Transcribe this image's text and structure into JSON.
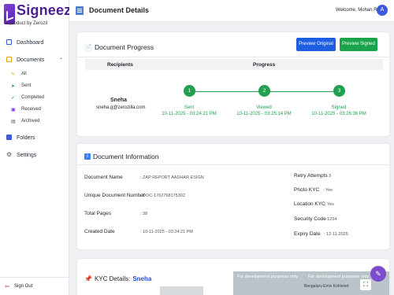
{
  "brand": {
    "name": "Signeez",
    "tagline": "A product by Zerozil",
    "toggle_icon": "double-chevron-left-icon"
  },
  "sidebar": {
    "items": [
      {
        "label": "Dashboard",
        "icon": "dashboard-icon",
        "color": "#3b5bdb"
      },
      {
        "label": "Documents",
        "icon": "document-icon",
        "color": "#e8a317"
      },
      {
        "label": "Folders",
        "icon": "folder-icon",
        "color": "#3b5bdb"
      },
      {
        "label": "Settings",
        "icon": "gear-icon",
        "color": "#555555"
      }
    ],
    "sub_items": [
      {
        "label": "All",
        "icon": "pen-icon"
      },
      {
        "label": "Sent",
        "icon": "send-icon"
      },
      {
        "label": "Completed",
        "icon": "check-icon"
      },
      {
        "label": "Received",
        "icon": "inbox-icon"
      },
      {
        "label": "Archived",
        "icon": "archive-icon"
      }
    ],
    "sign_out": "Sign Out"
  },
  "header": {
    "title": "Document Details",
    "welcome": "Welcome, Mohan Raj",
    "avatar_initial": "A"
  },
  "progress": {
    "title": "Document Progress",
    "preview_original": "Preview Original",
    "preview_signed": "Preview Signed",
    "col_recipients": "Recipients",
    "col_progress": "Progress",
    "recipient_name": "Sneha",
    "recipient_email": "sneha.g@zerozilla.com",
    "steps": [
      {
        "num": "1",
        "label": "Sent",
        "date": "10-11-2025 - 03:24:21 PM"
      },
      {
        "num": "2",
        "label": "Viewed",
        "date": "10-11-2025 - 03:25:14 PM"
      },
      {
        "num": "3",
        "label": "Signed",
        "date": "10-11-2025 - 03:26:36 PM"
      }
    ]
  },
  "info": {
    "title": "Document Information",
    "left": [
      {
        "label": "Document Name",
        "value": ": ZAP REPORT AADHAR ESIGN"
      },
      {
        "label": "Unique Document Number",
        "value": ": DOC-1762768175302"
      },
      {
        "label": "Total Pages",
        "value": ": 38"
      },
      {
        "label": "Created Date",
        "value": ": 10-11-2025 - 03:24:21 PM"
      }
    ],
    "right": [
      {
        "label": "Retry Attempts",
        "value": ": 3"
      },
      {
        "label": "Photo KYC",
        "value": ": Yes"
      },
      {
        "label": "Location KYC",
        "value": ": Yes"
      },
      {
        "label": "Security Code",
        "value": ": 1234"
      },
      {
        "label": "Expiry Date",
        "value": ": 12-11-2025"
      }
    ]
  },
  "kyc": {
    "title": "KYC Details:",
    "name": "Sneha",
    "map_watermark_1": "For development purposes only",
    "map_watermark_2": "For development purposes only",
    "map_place": "Bengaluru Emiv Kohlenet"
  }
}
